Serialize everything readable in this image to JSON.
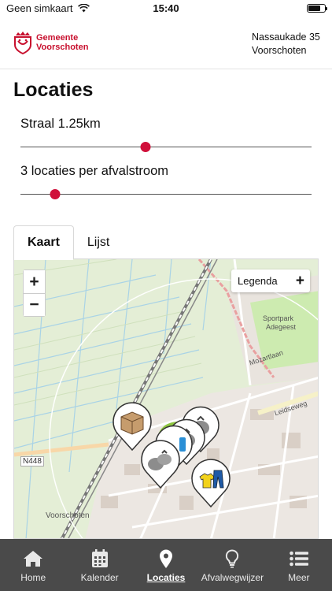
{
  "status": {
    "carrier": "Geen simkaart",
    "time": "15:40"
  },
  "header": {
    "logo_line1": "Gemeente",
    "logo_line2": "Voorschoten",
    "address_line1": "Nassaukade 35",
    "address_line2": "Voorschoten"
  },
  "page": {
    "title": "Locaties"
  },
  "radius_slider": {
    "label": "Straal 1.25km",
    "fraction": 0.43
  },
  "count_slider": {
    "label": "3 locaties per afvalstroom",
    "fraction": 0.12
  },
  "tabs": [
    {
      "label": "Kaart",
      "active": true
    },
    {
      "label": "Lijst",
      "active": false
    }
  ],
  "map": {
    "zoom_in": "+",
    "zoom_out": "−",
    "legend_label": "Legenda",
    "legend_toggle": "+",
    "place_labels": {
      "park": "Sportpark",
      "park2": "Adegeest",
      "street1": "Mozartlaan",
      "street2": "Leidseweg",
      "road": "N448",
      "town": "Voorschoten"
    }
  },
  "colors": {
    "brand_red": "#c8102e",
    "thumb": "#d0103a",
    "tabbar_bg": "#4a4a4a",
    "accent_green": "#8dc63f"
  },
  "nav": [
    {
      "label": "Home",
      "icon": "home-icon",
      "active": false
    },
    {
      "label": "Kalender",
      "icon": "calendar-icon",
      "active": false
    },
    {
      "label": "Locaties",
      "icon": "location-pin-icon",
      "active": true
    },
    {
      "label": "Afvalwegwijzer",
      "icon": "lightbulb-icon",
      "active": false
    },
    {
      "label": "Meer",
      "icon": "menu-list-icon",
      "active": false
    }
  ]
}
